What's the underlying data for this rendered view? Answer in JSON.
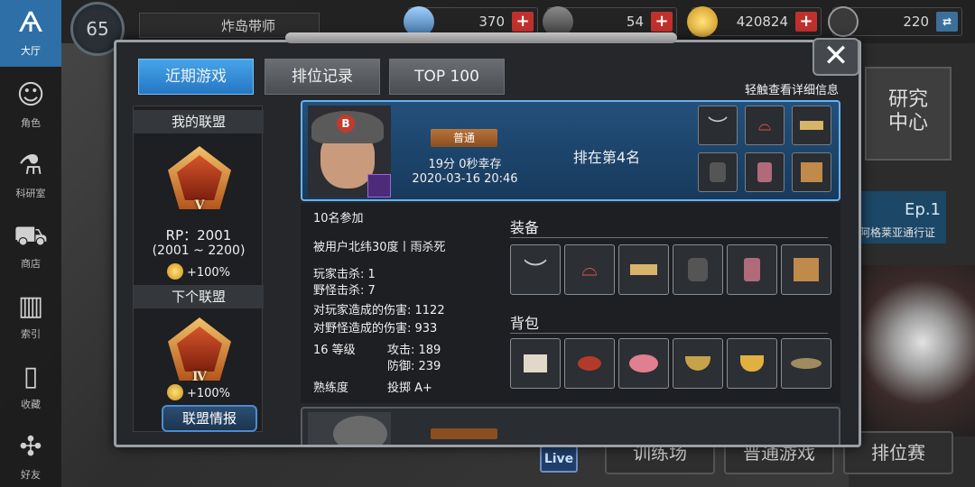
{
  "player": {
    "level": "65",
    "name": "炸岛带师"
  },
  "resources": [
    {
      "name": "gem",
      "value": "370",
      "icon": "gem-icon",
      "action": "plus-icon"
    },
    {
      "name": "ticket",
      "value": "54",
      "icon": "ticket-icon",
      "action": "plus-icon"
    },
    {
      "name": "coin",
      "value": "420824",
      "icon": "coin-icon",
      "action": "plus-icon"
    },
    {
      "name": "bp",
      "value": "220",
      "icon": "bp-icon",
      "action": "exchange-icon"
    }
  ],
  "sidebar": [
    {
      "label": "大厅",
      "icon": "lobby-icon",
      "active": true
    },
    {
      "label": "角色",
      "icon": "character-icon"
    },
    {
      "label": "科研室",
      "icon": "lab-icon"
    },
    {
      "label": "商店",
      "icon": "cart-icon"
    },
    {
      "label": "索引",
      "icon": "index-icon"
    },
    {
      "label": "收藏",
      "icon": "book-icon"
    },
    {
      "label": "好友",
      "icon": "gamepad-icon"
    }
  ],
  "background": {
    "research": "研究\n中心",
    "ep": "Ep.1",
    "ep_sub": "阿格莱亚通行证",
    "buttons": [
      "训练场",
      "普通游戏",
      "排位赛"
    ],
    "live": "Live"
  },
  "modal": {
    "tabs": [
      "近期游戏",
      "排位记录",
      "TOP 100"
    ],
    "active_tab": 0,
    "hint": "轻触查看详细信息"
  },
  "league": {
    "my_title": "我的联盟",
    "my_rank": "V",
    "rp": "RP：2001",
    "rp_range": "(2001 ~ 2200)",
    "bonus": "+100%",
    "next_title": "下个联盟",
    "next_rank": "Ⅳ",
    "next_bonus": "+100%",
    "button": "联盟情报"
  },
  "match": {
    "mode": "普通",
    "survive": "19分 0秒幸存",
    "datetime": "2020-03-16 20:46",
    "rank": "排在第4名",
    "participants": "10名参加",
    "killed_by": "被用户北纬30度丨雨杀死",
    "player_kills": "玩家击杀: 1",
    "monster_kills": "野怪击杀: 7",
    "player_damage": "对玩家造成的伤害: 1122",
    "monster_damage": "对野怪造成的伤害: 933",
    "level": "16 等级",
    "attack": "攻击: 189",
    "defense": "防御: 239",
    "mastery_label": "熟练度",
    "mastery_value": "投掷 A+",
    "equipment_title": "装备",
    "bag_title": "背包",
    "equipment": [
      "boomerang-icon",
      "glasses-icon",
      "bracer-icon",
      "armor-icon",
      "boots-icon",
      "crate-icon"
    ],
    "bag": [
      "scroll-icon",
      "crab-icon",
      "meat-icon",
      "pot-icon",
      "bowl-icon",
      "fish-icon"
    ]
  }
}
